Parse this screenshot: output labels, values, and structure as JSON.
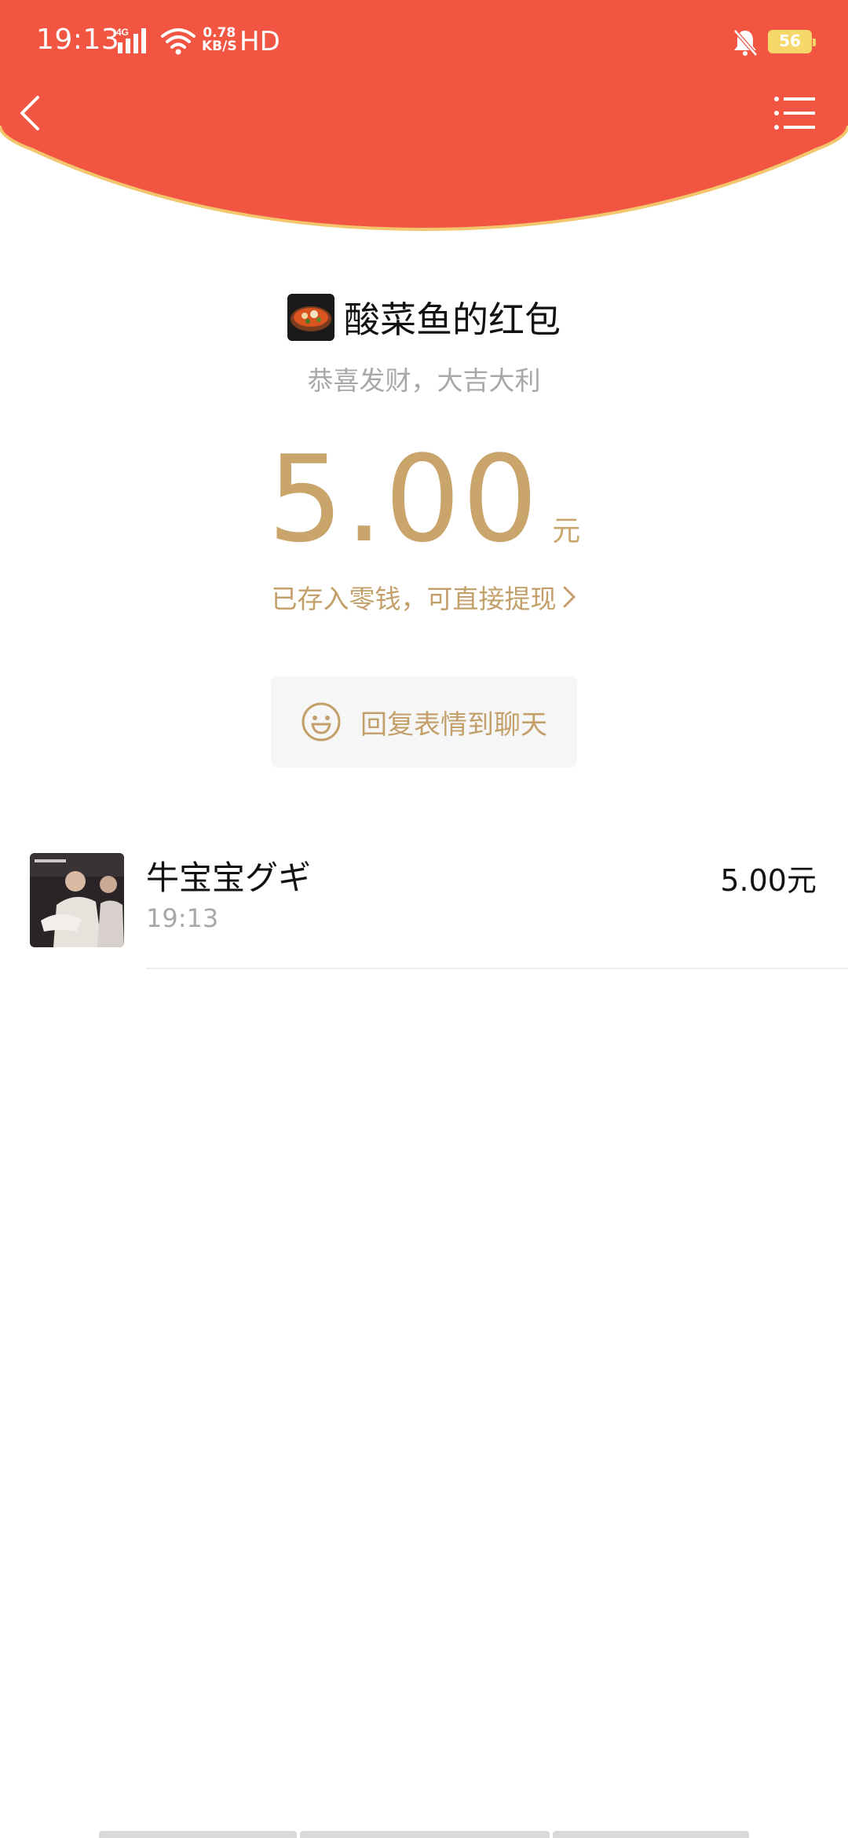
{
  "status_bar": {
    "time": "19:13",
    "network": "4G",
    "speed_value": "0.78",
    "speed_unit": "KB/S",
    "hd_label": "HD",
    "battery_level": "56"
  },
  "packet": {
    "title": "酸菜鱼的红包",
    "greeting": "恭喜发财，大吉大利",
    "amount": "5.00",
    "currency": "元",
    "saved_notice": "已存入零钱，可直接提现",
    "reply_label": "回复表情到聊天"
  },
  "receiver": {
    "name": "牛宝宝グギ",
    "time": "19:13",
    "amount": "5.00元"
  },
  "colors": {
    "header_red": "#f25542",
    "header_border": "#f3c56d",
    "gold": "#c9a56c"
  }
}
